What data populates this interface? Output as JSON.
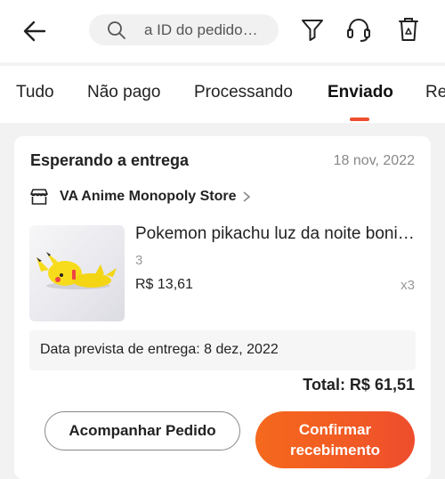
{
  "header": {
    "back_icon": "arrow-left-icon",
    "search": {
      "placeholder": "a ID do pedido…",
      "icon": "search-icon"
    },
    "actions": [
      {
        "name": "filter",
        "icon": "funnel-icon"
      },
      {
        "name": "support",
        "icon": "headset-icon"
      },
      {
        "name": "recycle",
        "icon": "recycle-bin-icon"
      }
    ]
  },
  "tabs": [
    {
      "label": "Tudo",
      "active": false
    },
    {
      "label": "Não pago",
      "active": false
    },
    {
      "label": "Processando",
      "active": false
    },
    {
      "label": "Enviado",
      "active": true
    },
    {
      "label": "Re",
      "active": false
    }
  ],
  "order": {
    "status": "Esperando a entrega",
    "date": "18 nov, 2022",
    "store_name": "VA Anime Monopoly Store",
    "item": {
      "name": "Pokemon pikachu luz da noite boni…",
      "variant": "3",
      "price": "R$ 13,61",
      "quantity": "x3",
      "image": "pikachu-night-light"
    },
    "delivery_text": "Data prevista de entrega: 8 dez, 2022",
    "total": "Total: R$ 61,51",
    "buttons": {
      "track": "Acompanhar Pedido",
      "confirm": "Confirmar recebimento"
    }
  },
  "colors": {
    "accent": "#ee4d2d",
    "background": "#f2f2f2",
    "card": "#ffffff"
  }
}
